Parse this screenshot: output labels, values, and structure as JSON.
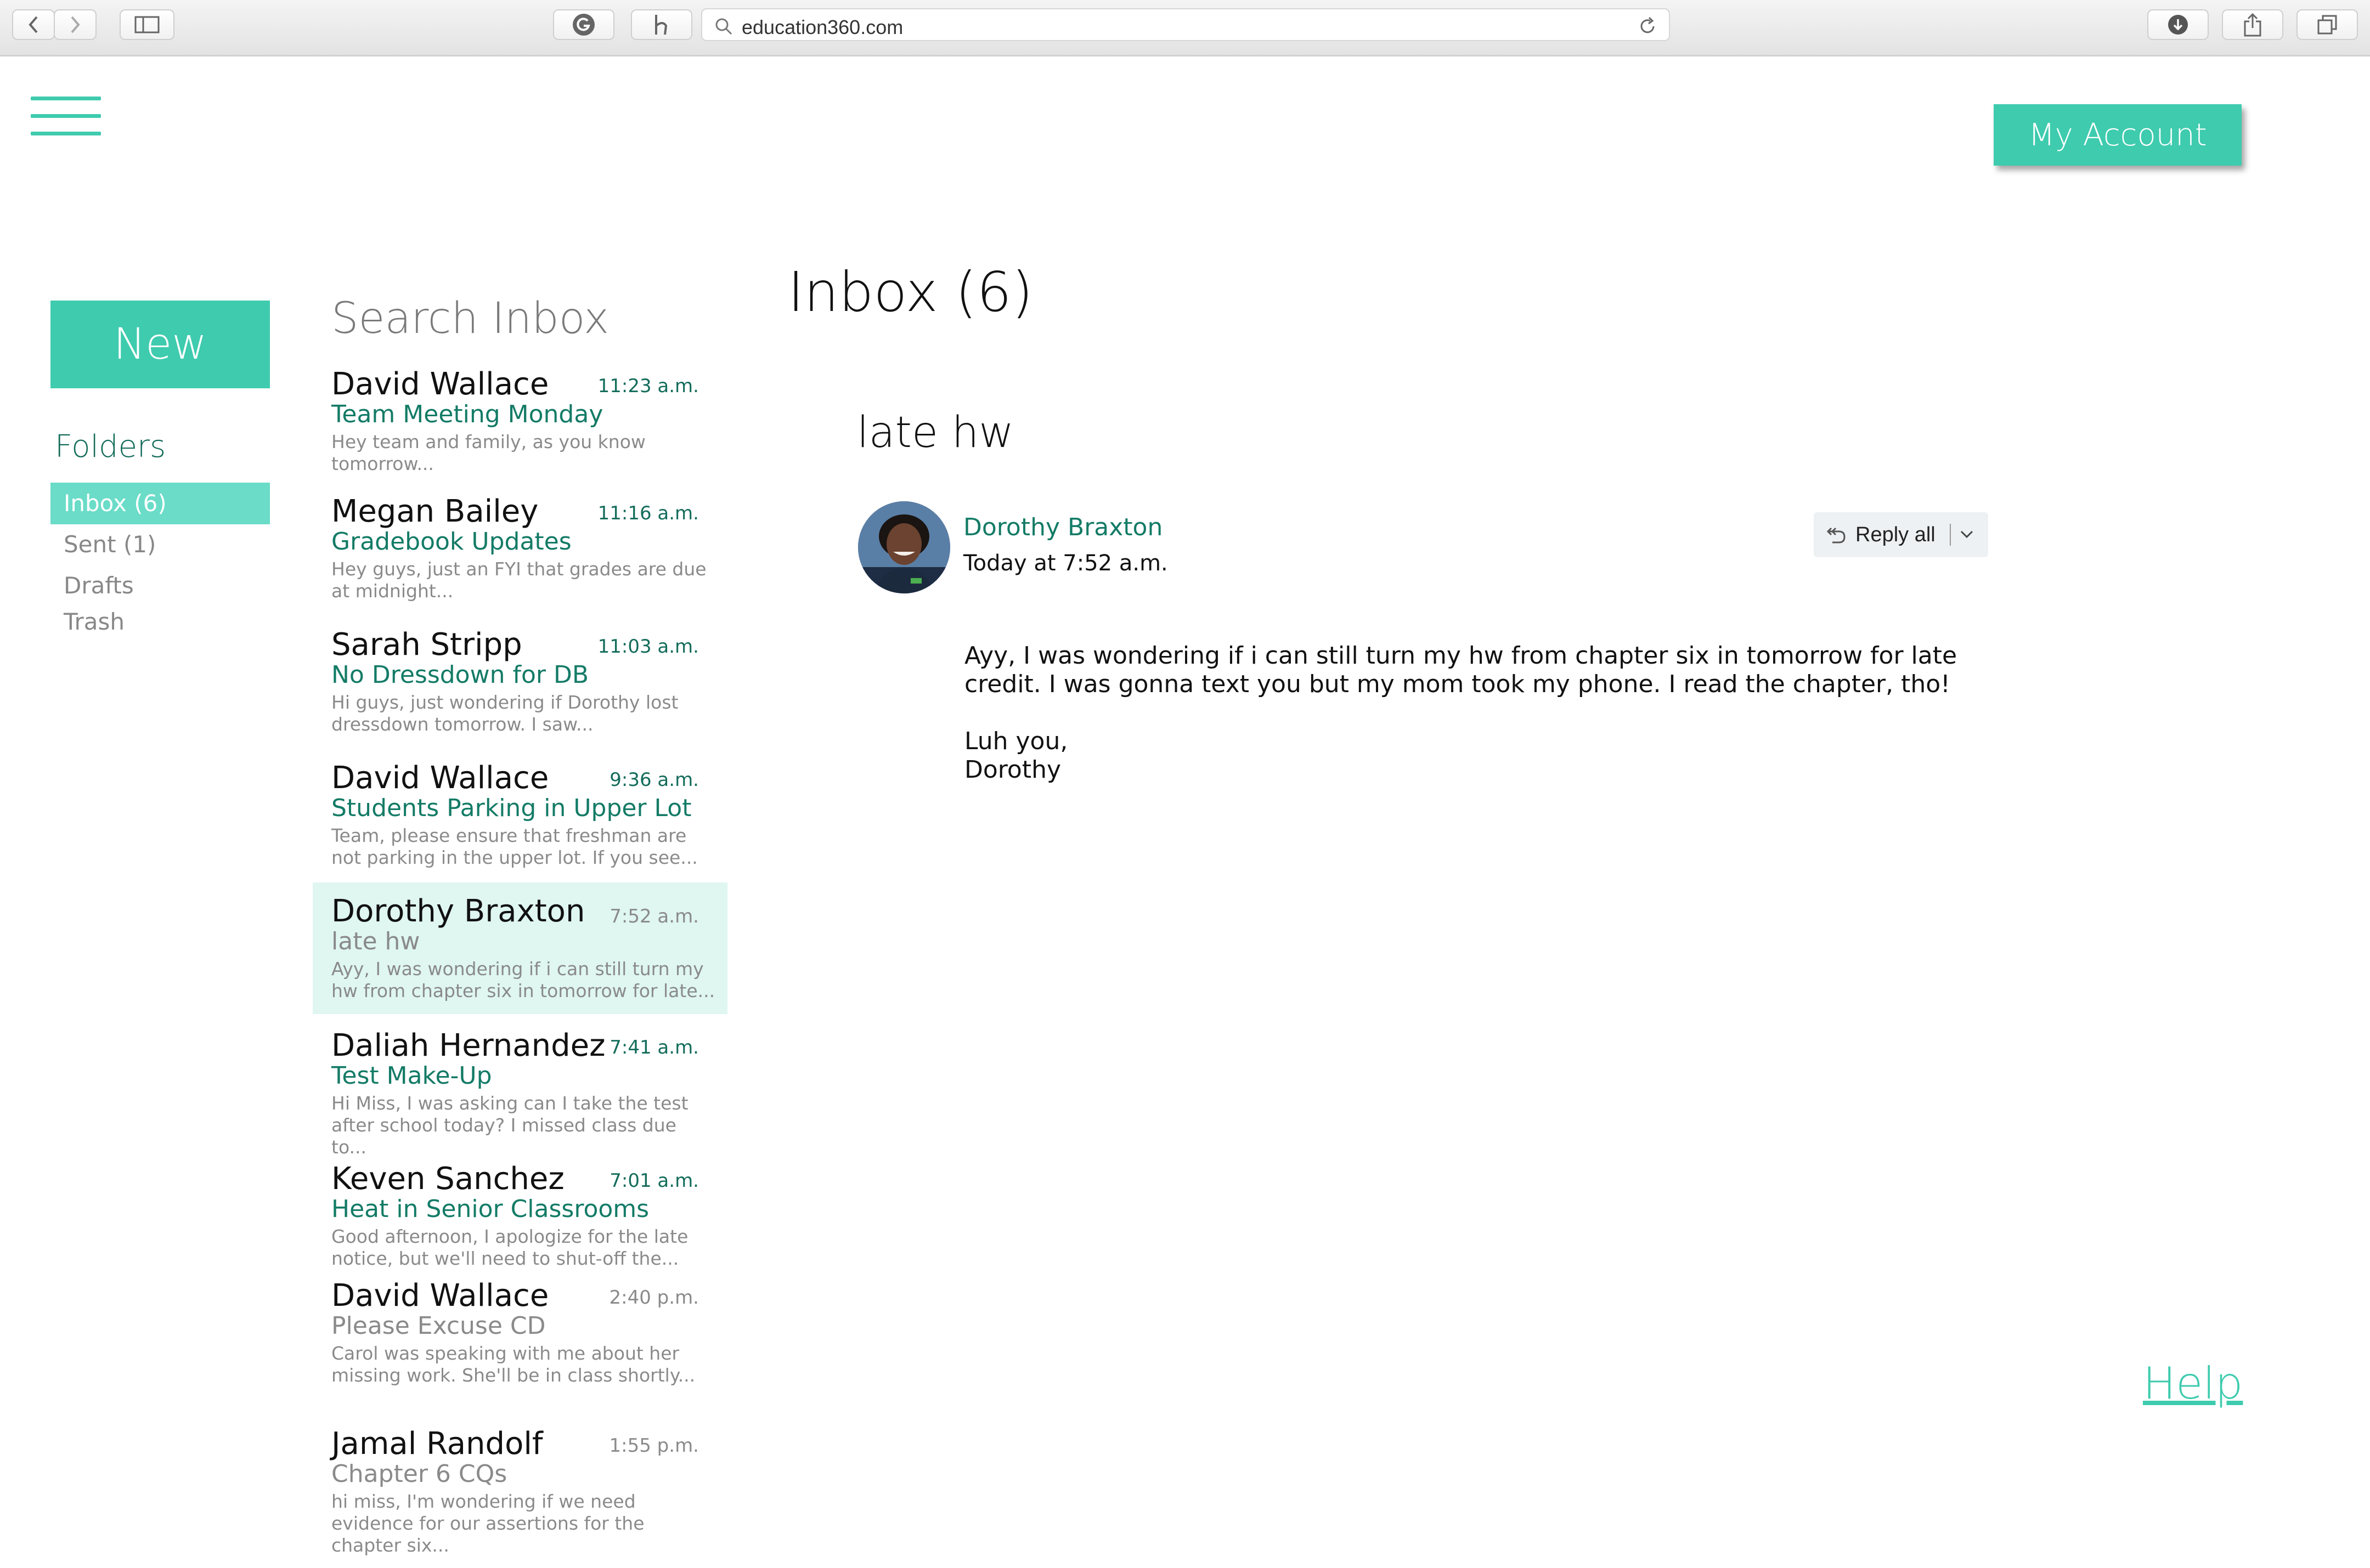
{
  "browser": {
    "url": "education360.com",
    "icons": [
      "back-icon",
      "forward-icon",
      "sidebar-icon",
      "grammarly-icon",
      "honey-icon",
      "search-icon",
      "reload-icon",
      "download-icon",
      "share-icon",
      "tabs-icon"
    ]
  },
  "header": {
    "account_label": "My Account"
  },
  "sidebar": {
    "new_label": "New",
    "folders_title": "Folders",
    "folders": [
      {
        "label": "Inbox (6)"
      },
      {
        "label": "Sent (1)"
      },
      {
        "label": "Drafts"
      },
      {
        "label": "Trash"
      }
    ]
  },
  "message_list": {
    "search_label": "Search Inbox",
    "messages": [
      {
        "sender": "David Wallace",
        "time": "11:23 a.m.",
        "subject": "Team Meeting Monday",
        "preview": "Hey team and family, as you know tomorrow..."
      },
      {
        "sender": "Megan Bailey",
        "time": "11:16 a.m.",
        "subject": "Gradebook Updates",
        "preview": "Hey guys, just an FYI that grades are due at midnight..."
      },
      {
        "sender": "Sarah Stripp",
        "time": "11:03 a.m.",
        "subject": "No Dressdown for DB",
        "preview": "Hi guys, just wondering if Dorothy lost dressdown tomorrow. I saw..."
      },
      {
        "sender": "David Wallace",
        "time": "9:36 a.m.",
        "subject": "Students Parking in Upper Lot",
        "preview": "Team, please ensure that freshman are not parking in the upper lot. If you see..."
      },
      {
        "sender": "Dorothy Braxton",
        "time": "7:52 a.m.",
        "subject": "late hw",
        "preview": "Ayy, I was wondering if i can still turn my hw from chapter six in tomorrow for late..."
      },
      {
        "sender": "Daliah Hernandez",
        "time": "7:41 a.m.",
        "subject": "Test Make-Up",
        "preview": "Hi Miss, I was asking can I take the test after school today? I missed class due to..."
      },
      {
        "sender": "Keven Sanchez",
        "time": "7:01 a.m.",
        "subject": "Heat in Senior Classrooms",
        "preview": "Good afternoon, I apologize for the late notice, but we'll need to shut-off the..."
      },
      {
        "sender": "David Wallace",
        "time": "2:40 p.m.",
        "subject": "Please Excuse CD",
        "preview": "Carol was speaking with me about her missing work. She'll be in class shortly..."
      },
      {
        "sender": "Jamal Randolf",
        "time": "1:55 p.m.",
        "subject": "Chapter 6 CQs",
        "preview": "hi miss, I'm wondering if we need evidence for our assertions for the chapter six..."
      }
    ]
  },
  "reading_pane": {
    "inbox_title": "Inbox (6)",
    "subject": "late hw",
    "from_name": "Dorothy Braxton",
    "from_date": "Today at 7:52 a.m.",
    "reply_all_label": "Reply all",
    "body": "Ayy, I was wondering if i can still turn my hw from chapter six in tomorrow for late credit. I was gonna text you but my mom took my phone. I read the chapter, tho!\n\nLuh you,\nDorothy"
  },
  "footer": {
    "help_label": "Help"
  },
  "colors": {
    "accent": "#3ecbae",
    "accent_dark": "#137b66",
    "selected_row": "#dff6f1",
    "active_folder": "#6adcc8"
  }
}
